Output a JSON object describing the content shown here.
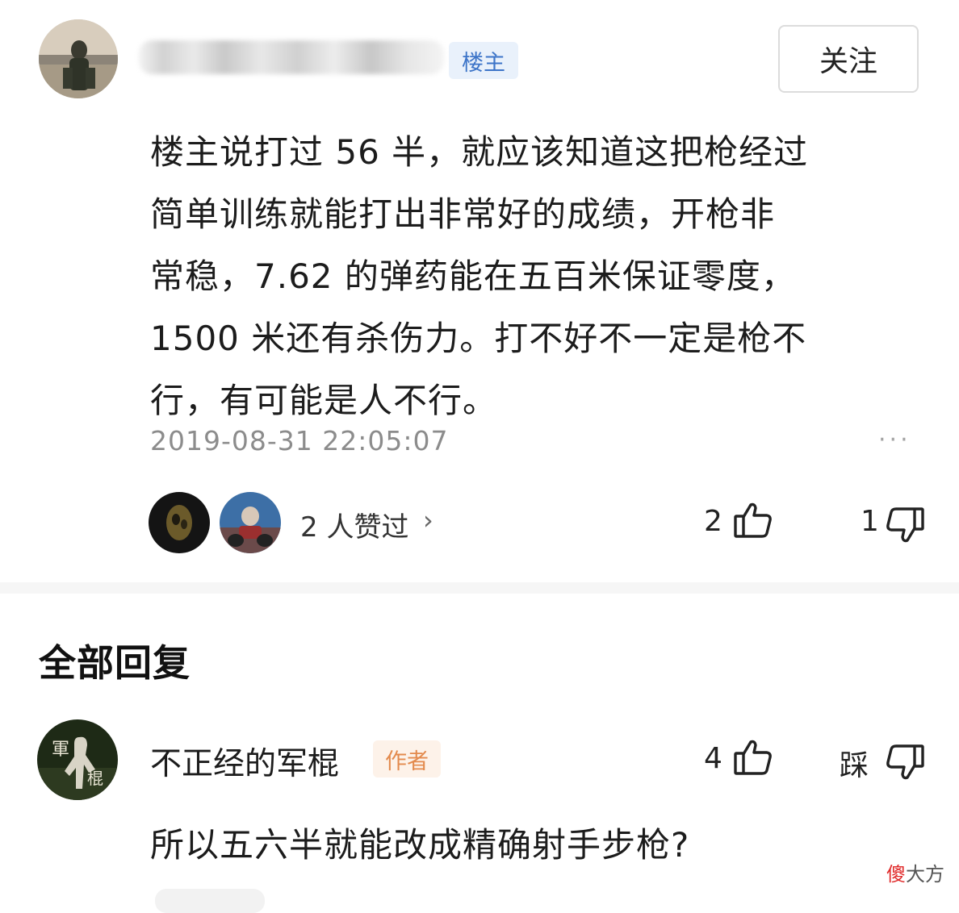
{
  "post": {
    "username": "",
    "badge": "楼主",
    "follow_label": "关注",
    "content": "楼主说打过 56 半，就应该知道这把枪经过\n简单训练就能打出非常好的成绩，开枪非\n常稳，7.62 的弹药能在五百米保证零度，\n1500 米还有杀伤力。打不好不一定是枪不\n行，有可能是人不行。",
    "timestamp": "2019-08-31 22:05:07",
    "more_icon": "more-dots-icon",
    "liked_by_text": "2 人赞过",
    "liked_by_chevron": "›",
    "like_count": "2",
    "dislike_count": "1"
  },
  "replies_section": {
    "title": "全部回复"
  },
  "reply": {
    "username": "不正经的军棍",
    "badge": "作者",
    "like_count": "4",
    "dislike_label": "踩",
    "content": "所以五六半就能改成精确射手步枪?"
  },
  "watermark": {
    "part1": "傻",
    "part2": "大方"
  },
  "colors": {
    "owner_badge_bg": "#e9f1fb",
    "owner_badge_text": "#3c74c8",
    "author_badge_bg": "#fdf2e9",
    "author_badge_text": "#e38a4d",
    "timestamp": "#8c8c8c",
    "watermark_red": "#e02a2a"
  }
}
